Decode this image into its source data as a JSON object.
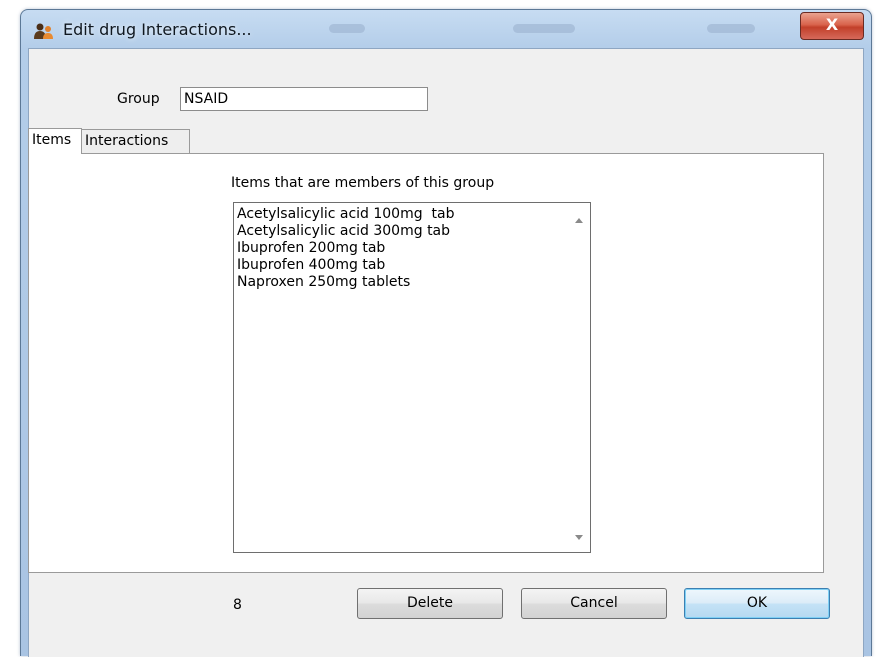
{
  "window": {
    "title": "Edit drug Interactions...",
    "close_label": "X"
  },
  "form": {
    "group_label": "Group",
    "group_value": "NSAID"
  },
  "tabs": [
    {
      "label": "Items",
      "selected": true
    },
    {
      "label": "Interactions",
      "selected": false
    }
  ],
  "items_panel": {
    "caption": "Items that are members of this group",
    "items": [
      "Acetylsalicylic acid 100mg  tab",
      "Acetylsalicylic acid 300mg tab",
      "Ibuprofen 200mg tab",
      "Ibuprofen 400mg tab",
      "Naproxen 250mg tablets"
    ]
  },
  "footer": {
    "count": "8",
    "delete_label": "Delete",
    "cancel_label": "Cancel",
    "ok_label": "OK"
  },
  "icons": {
    "app": "people-icon",
    "scroll_up": "scroll-up-arrow-icon",
    "scroll_down": "scroll-down-arrow-icon"
  },
  "colors": {
    "title_bar": "#b3cde9",
    "close_button": "#c7432d",
    "client": "#f0f0f0",
    "ok_border": "#3c7fb1"
  }
}
